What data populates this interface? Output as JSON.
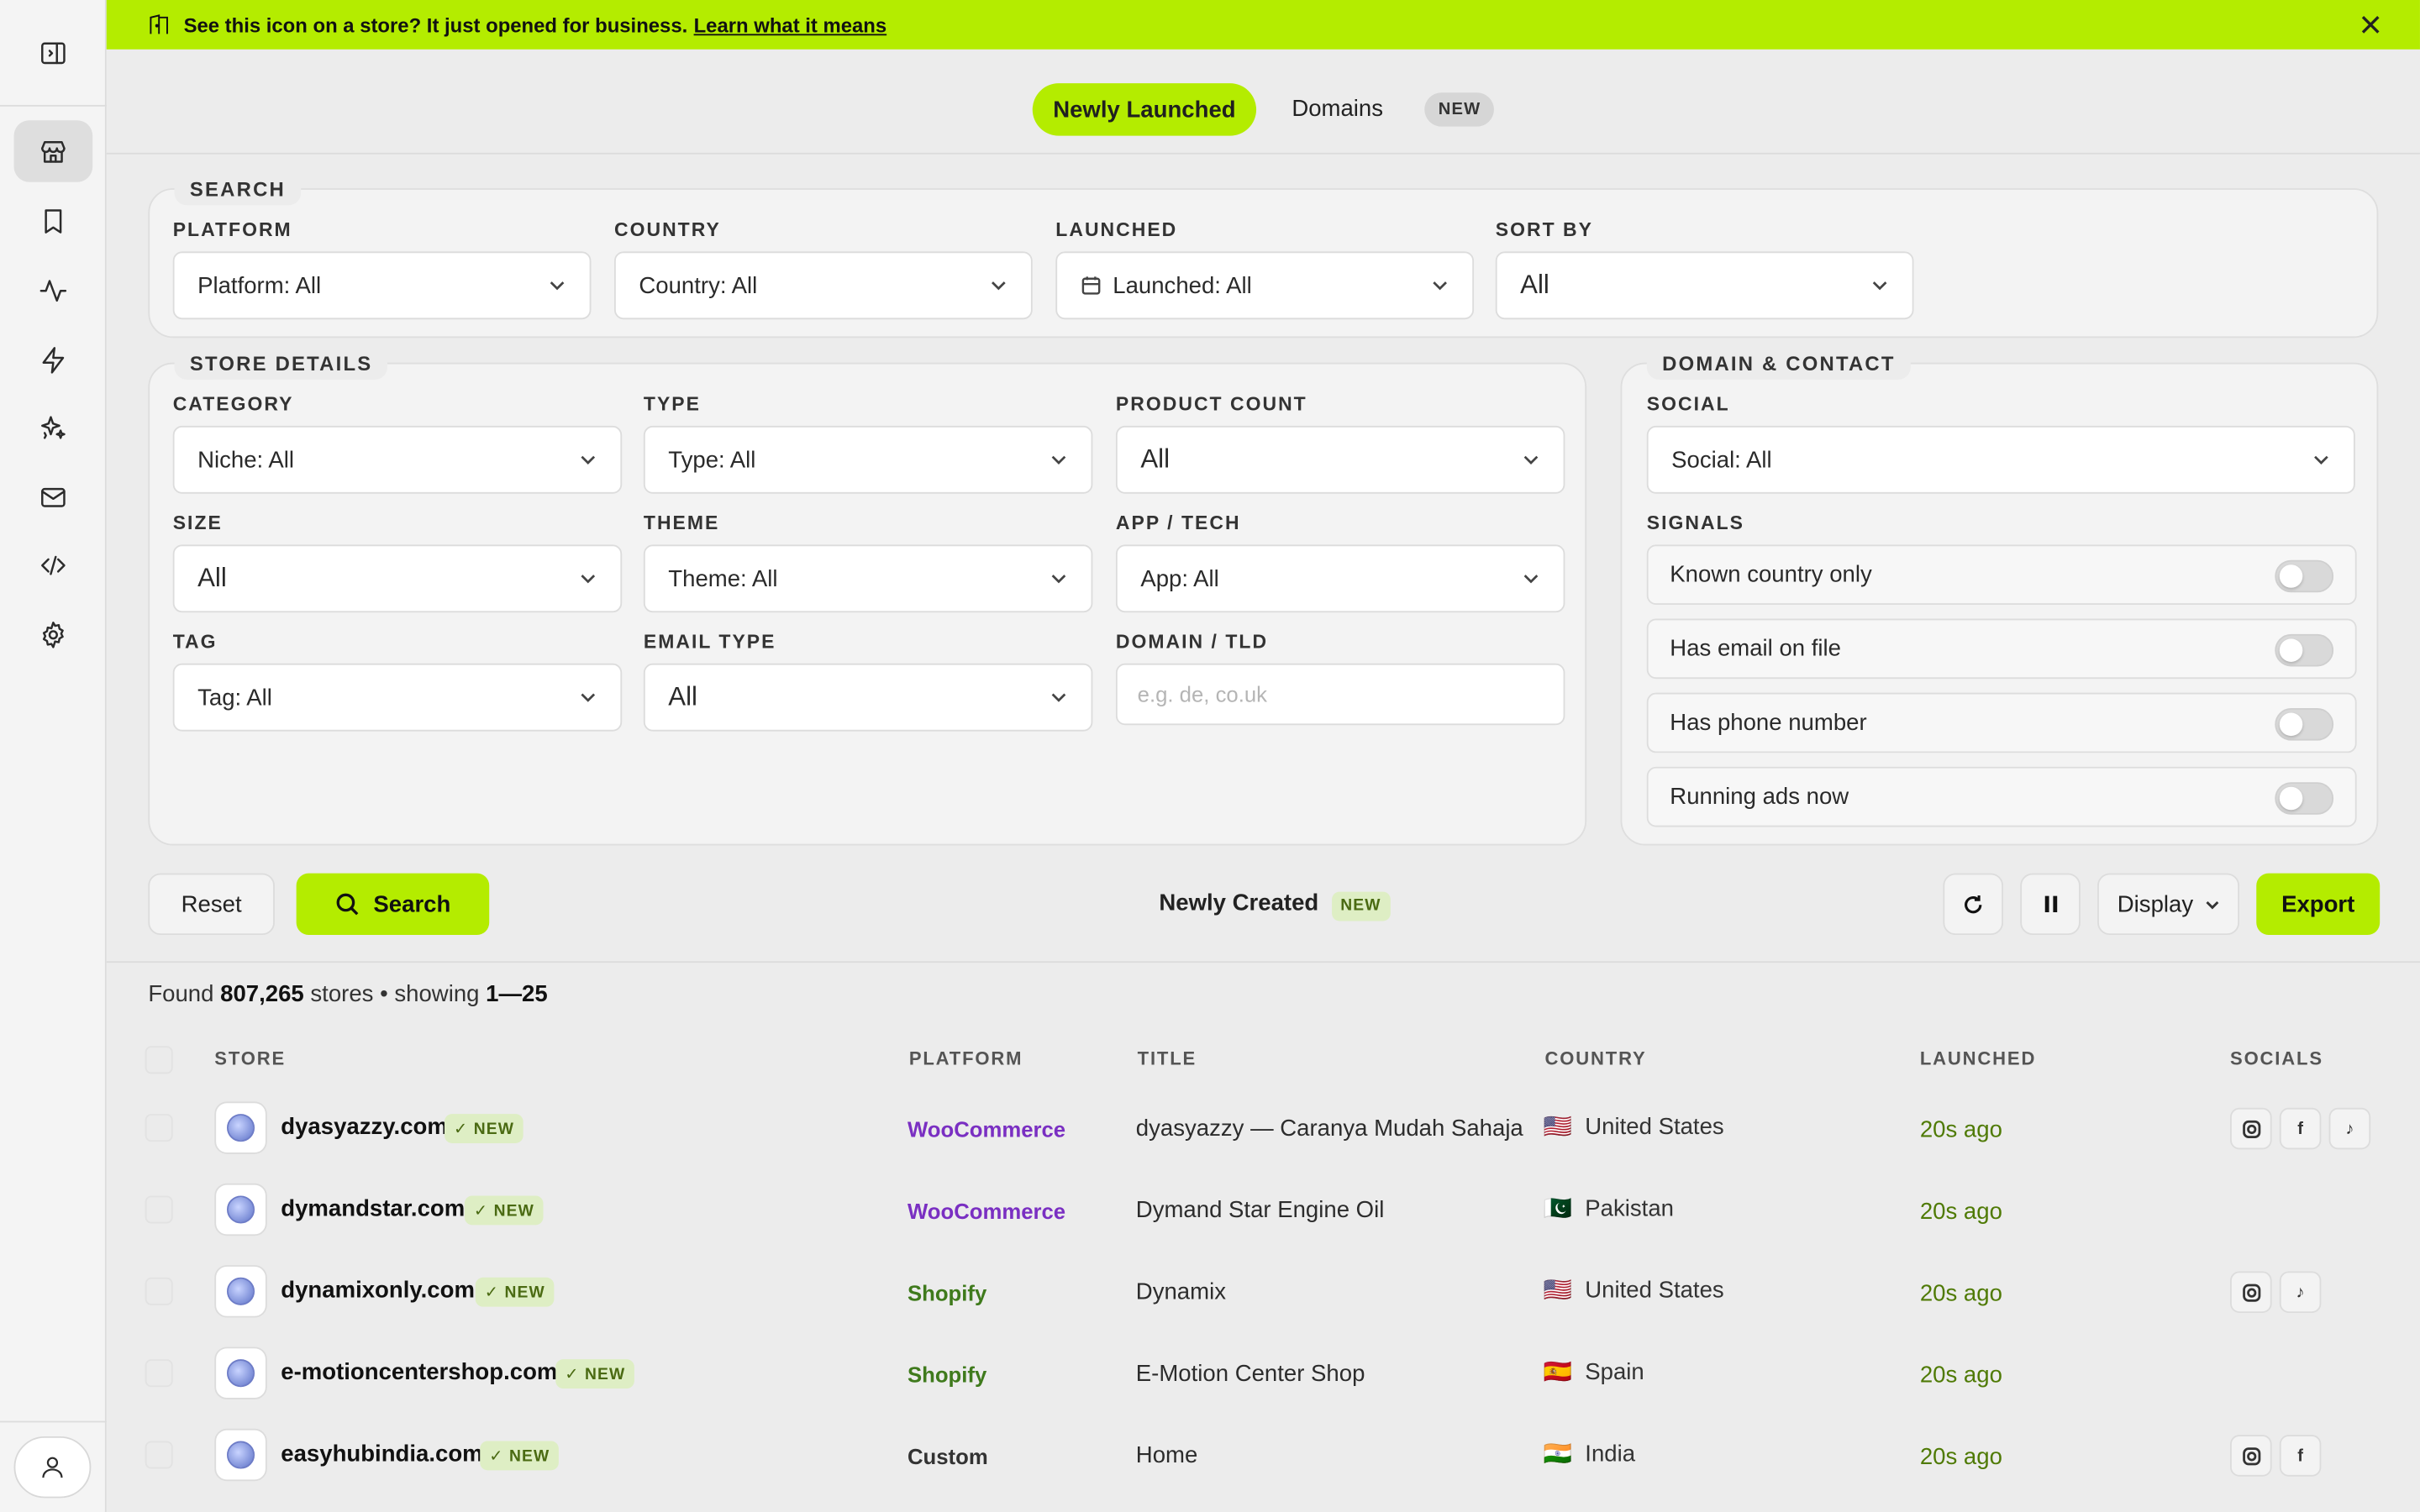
{
  "colors": {
    "accent": "#b4ec00",
    "woocommerce": "#7a2fc2",
    "shopify": "#3f7a1c",
    "custom": "#333333",
    "launched": "#4f7a05"
  },
  "sidebar": {
    "items": [
      {
        "icon": "sidebar-toggle-icon"
      },
      {
        "icon": "store-icon",
        "active": true
      },
      {
        "icon": "bookmark-icon"
      },
      {
        "icon": "activity-icon"
      },
      {
        "icon": "lightning-icon"
      },
      {
        "icon": "sparkles-icon"
      },
      {
        "icon": "mail-icon"
      },
      {
        "icon": "code-icon"
      },
      {
        "icon": "gear-icon"
      }
    ],
    "profile_icon": "user-icon"
  },
  "banner": {
    "text": "See this icon on a store? It just opened for business.",
    "link": "Learn what it means"
  },
  "tabs": {
    "active": "Newly Launched",
    "second": "Domains",
    "new_badge": "NEW"
  },
  "search_panel": {
    "legend": "SEARCH",
    "platform": {
      "label": "PLATFORM",
      "value": "Platform: All"
    },
    "country": {
      "label": "COUNTRY",
      "value": "Country: All"
    },
    "launched": {
      "label": "LAUNCHED",
      "value": "Launched: All"
    },
    "sort_by": {
      "label": "SORT BY",
      "value": "All"
    }
  },
  "store_details": {
    "legend": "STORE DETAILS",
    "category": {
      "label": "CATEGORY",
      "value": "Niche: All"
    },
    "type": {
      "label": "TYPE",
      "value": "Type: All"
    },
    "product_count": {
      "label": "PRODUCT COUNT",
      "value": "All"
    },
    "size": {
      "label": "SIZE",
      "value": "All"
    },
    "theme": {
      "label": "THEME",
      "value": "Theme: All"
    },
    "app_tech": {
      "label": "APP / TECH",
      "value": "App: All"
    },
    "tag": {
      "label": "TAG",
      "value": "Tag: All"
    },
    "email_type": {
      "label": "EMAIL TYPE",
      "value": "All"
    },
    "domain_tld": {
      "label": "DOMAIN / TLD",
      "placeholder": "e.g. de, co.uk"
    }
  },
  "domain_contact": {
    "legend": "DOMAIN & CONTACT",
    "social": {
      "label": "SOCIAL",
      "value": "Social: All"
    },
    "signals_label": "SIGNALS",
    "signals": [
      "Known country only",
      "Has email on file",
      "Has phone number",
      "Running ads now"
    ]
  },
  "actions": {
    "reset": "Reset",
    "search": "Search",
    "newly_created": "Newly Created",
    "newly_created_badge": "NEW",
    "display": "Display",
    "export": "Export"
  },
  "results": {
    "found_prefix": "Found",
    "count": "807,265",
    "stores_word": "stores • showing",
    "range": "1—25",
    "columns": [
      "STORE",
      "PLATFORM",
      "TITLE",
      "COUNTRY",
      "LAUNCHED",
      "SOCIALS"
    ],
    "rows": [
      {
        "domain": "dyasyazzy.com",
        "badge": "✓ NEW",
        "platform": "WooCommerce",
        "title": "dyasyazzy — Caranya Mudah Sahaja",
        "flag": "🇺🇸",
        "country": "United States",
        "launched": "20s ago",
        "socials": [
          "instagram-icon",
          "facebook-icon",
          "tiktok-icon"
        ]
      },
      {
        "domain": "dymandstar.com",
        "badge": "✓ NEW",
        "platform": "WooCommerce",
        "title": "Dymand Star Engine Oil",
        "flag": "🇵🇰",
        "country": "Pakistan",
        "launched": "20s ago",
        "socials": []
      },
      {
        "domain": "dynamixonly.com",
        "badge": "✓ NEW",
        "platform": "Shopify",
        "title": "Dynamix",
        "flag": "🇺🇸",
        "country": "United States",
        "launched": "20s ago",
        "socials": [
          "instagram-icon",
          "tiktok-icon"
        ]
      },
      {
        "domain": "e-motioncentershop.com",
        "badge": "✓ NEW",
        "platform": "Shopify",
        "title": "E-Motion Center Shop",
        "flag": "🇪🇸",
        "country": "Spain",
        "launched": "20s ago",
        "socials": []
      },
      {
        "domain": "easyhubindia.com",
        "badge": "✓ NEW",
        "platform": "Custom",
        "title": "Home",
        "flag": "🇮🇳",
        "country": "India",
        "launched": "20s ago",
        "socials": [
          "instagram-icon",
          "facebook-icon"
        ]
      }
    ]
  }
}
